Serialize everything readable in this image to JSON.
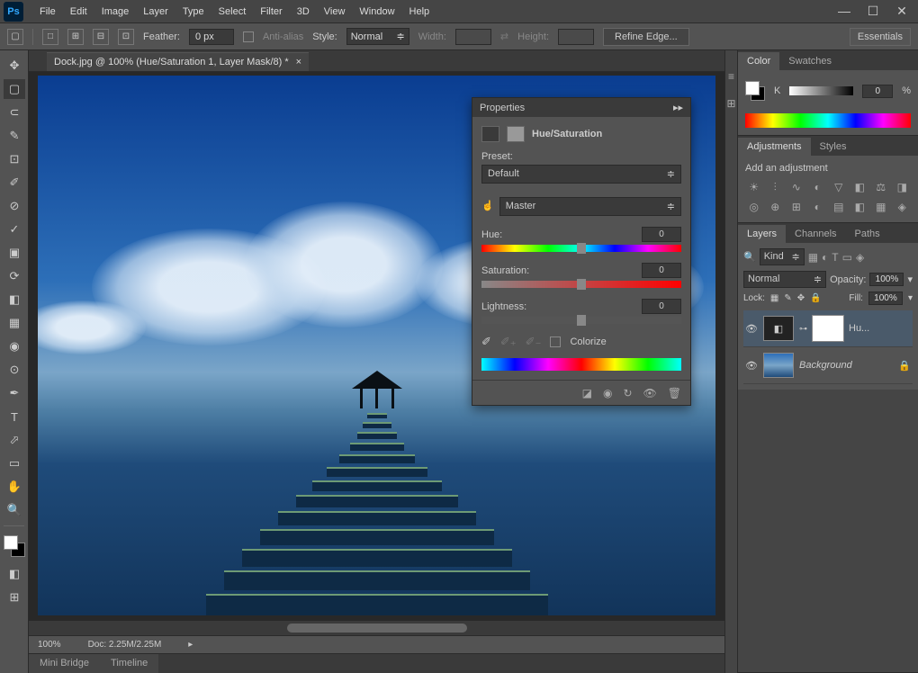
{
  "app": {
    "logo": "Ps"
  },
  "menubar": [
    "File",
    "Edit",
    "Image",
    "Layer",
    "Type",
    "Select",
    "Filter",
    "3D",
    "View",
    "Window",
    "Help"
  ],
  "options": {
    "feather_label": "Feather:",
    "feather_value": "0 px",
    "antialias_label": "Anti-alias",
    "style_label": "Style:",
    "style_value": "Normal",
    "width_label": "Width:",
    "height_label": "Height:",
    "refine_label": "Refine Edge...",
    "workspace": "Essentials"
  },
  "document": {
    "tab_title": "Dock.jpg @ 100% (Hue/Saturation 1, Layer Mask/8) *",
    "zoom": "100%",
    "doc_size": "Doc: 2.25M/2.25M"
  },
  "bottom_tabs": [
    "Mini Bridge",
    "Timeline"
  ],
  "panels": {
    "color": {
      "tabs": [
        "Color",
        "Swatches"
      ],
      "channel": "K",
      "value": "0",
      "unit": "%"
    },
    "adjustments": {
      "tabs": [
        "Adjustments",
        "Styles"
      ],
      "label": "Add an adjustment"
    },
    "layers": {
      "tabs": [
        "Layers",
        "Channels",
        "Paths"
      ],
      "filter_label": "Kind",
      "blend_mode": "Normal",
      "opacity_label": "Opacity:",
      "opacity_value": "100%",
      "lock_label": "Lock:",
      "fill_label": "Fill:",
      "fill_value": "100%",
      "items": [
        {
          "name": "Hu...",
          "has_mask": true
        },
        {
          "name": "Background",
          "locked": true
        }
      ]
    }
  },
  "properties": {
    "title": "Properties",
    "adjustment_name": "Hue/Saturation",
    "preset_label": "Preset:",
    "preset_value": "Default",
    "channel_value": "Master",
    "hue_label": "Hue:",
    "hue_value": "0",
    "saturation_label": "Saturation:",
    "saturation_value": "0",
    "lightness_label": "Lightness:",
    "lightness_value": "0",
    "colorize_label": "Colorize"
  }
}
